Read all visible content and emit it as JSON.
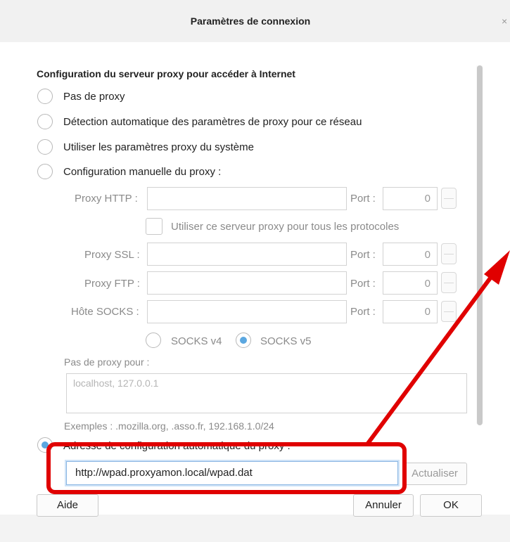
{
  "dialog": {
    "title": "Paramètres de connexion",
    "close_glyph": "×"
  },
  "section_title": "Configuration du serveur proxy pour accéder à Internet",
  "options": {
    "no_proxy": "Pas de proxy",
    "auto_detect": "Détection automatique des paramètres de proxy pour ce réseau",
    "system": "Utiliser les paramètres proxy du système",
    "manual": "Configuration manuelle du proxy :",
    "auto_config": "Adresse de configuration automatique du proxy :"
  },
  "manual": {
    "http_label": "Proxy HTTP :",
    "ssl_label": "Proxy SSL :",
    "ftp_label": "Proxy FTP :",
    "socks_label": "Hôte SOCKS :",
    "port_label": "Port :",
    "http_port": "0",
    "ssl_port": "0",
    "ftp_port": "0",
    "socks_port": "0",
    "share_label": "Utiliser ce serveur proxy pour tous les protocoles",
    "socks_v4": "SOCKS v4",
    "socks_v5": "SOCKS v5"
  },
  "no_proxy_for": {
    "label": "Pas de proxy pour :",
    "value": "localhost, 127.0.0.1",
    "examples": "Exemples : .mozilla.org, .asso.fr, 192.168.1.0/24"
  },
  "auto_config": {
    "url": "http://wpad.proxyamon.local/wpad.dat",
    "reload_label": "Actualiser"
  },
  "buttons": {
    "help": "Aide",
    "cancel": "Annuler",
    "ok": "OK"
  },
  "colors": {
    "accent": "#5ba7e0",
    "annotation": "#e00000"
  },
  "annotation": {
    "type": "red-arrow-and-box"
  }
}
